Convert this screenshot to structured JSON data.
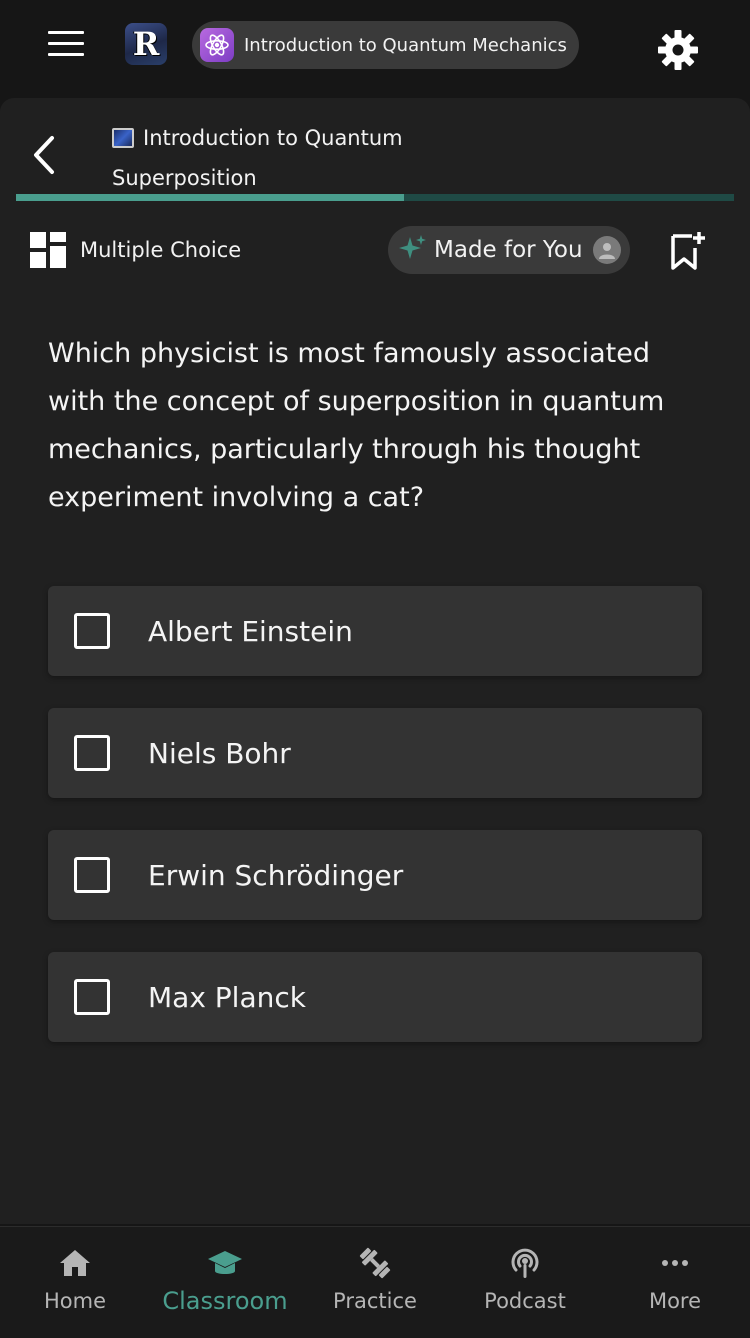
{
  "topbar": {
    "menu_icon": "hamburger-menu-icon",
    "app_logo_letter": "R",
    "course_chip": {
      "icon": "atom-icon",
      "label": "Introduction to Quantum Mechanics"
    },
    "settings_icon": "gear-icon"
  },
  "lesson": {
    "back_icon": "chevron-left-icon",
    "title_line1": "Introduction to Quantum",
    "title_line2": "Superposition",
    "progress_fraction": 0.54,
    "question_type": "Multiple Choice",
    "made_for_you_label": "Made for You",
    "bookmark_icon": "bookmark-add-icon"
  },
  "question": {
    "text": "Which physicist is most famously associated with the concept of superposition in quantum mechanics, particularly through his thought experiment involving a cat?"
  },
  "options": [
    {
      "label": "Albert Einstein",
      "checked": false
    },
    {
      "label": "Niels Bohr",
      "checked": false
    },
    {
      "label": "Erwin Schrödinger",
      "checked": false
    },
    {
      "label": "Max Planck",
      "checked": false
    }
  ],
  "bottom_nav": [
    {
      "label": "Home",
      "icon": "home-icon",
      "active": false
    },
    {
      "label": "Classroom",
      "icon": "graduation-cap-icon",
      "active": true
    },
    {
      "label": "Practice",
      "icon": "dumbbell-icon",
      "active": false
    },
    {
      "label": "Podcast",
      "icon": "podcast-icon",
      "active": false
    },
    {
      "label": "More",
      "icon": "more-dots-icon",
      "active": false
    }
  ],
  "colors": {
    "accent": "#4a9e8e",
    "progress_track": "#1f4a45",
    "background": "#161616",
    "card": "#202020",
    "option_bg": "#333333",
    "chip_bg": "#3a3a3a"
  }
}
